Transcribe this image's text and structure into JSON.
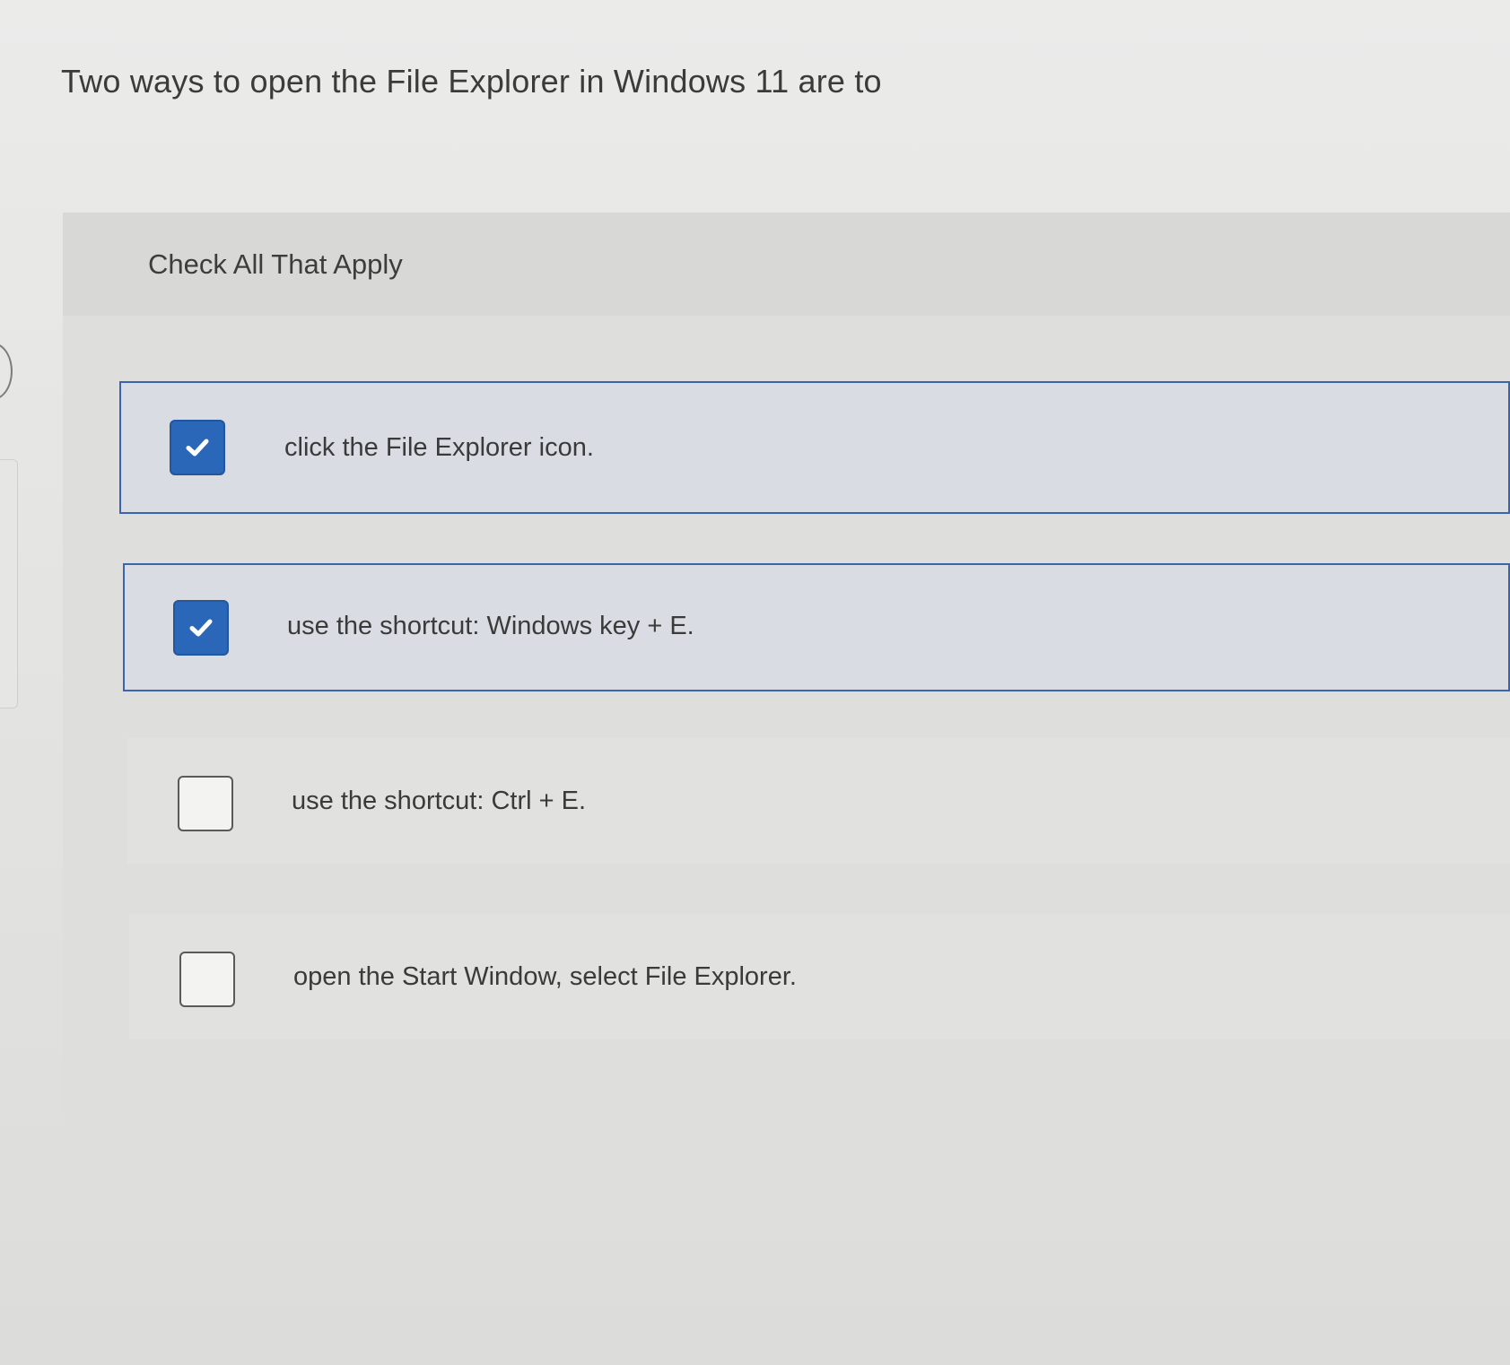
{
  "question": {
    "text": "Two ways to open the File Explorer in Windows 11 are to"
  },
  "instructions": "Check All That Apply",
  "options": [
    {
      "label": "click the File Explorer icon.",
      "checked": true,
      "icon": "checkmark-icon"
    },
    {
      "label": "use the shortcut: Windows key + E.",
      "checked": true,
      "icon": "checkmark-icon"
    },
    {
      "label": "use the shortcut: Ctrl + E.",
      "checked": false,
      "icon": ""
    },
    {
      "label": "open the Start Window, select File Explorer.",
      "checked": false,
      "icon": ""
    }
  ],
  "colors": {
    "accent": "#2b67b8",
    "selected_border": "#3a64ad",
    "selected_background": "#d9dde3"
  }
}
